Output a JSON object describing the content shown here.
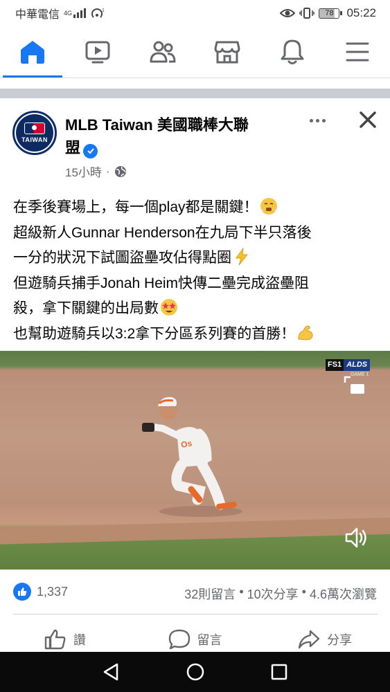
{
  "status_bar": {
    "carrier": "中華電信",
    "network": "4G",
    "battery": "78",
    "time": "05:22"
  },
  "nav": {
    "items": [
      {
        "icon": "home-icon",
        "active": true
      },
      {
        "icon": "video-icon",
        "active": false
      },
      {
        "icon": "friends-icon",
        "active": false
      },
      {
        "icon": "marketplace-icon",
        "active": false
      },
      {
        "icon": "bell-icon",
        "active": false
      },
      {
        "icon": "menu-icon",
        "active": false
      }
    ]
  },
  "post": {
    "page_name_line1": "MLB Taiwan 美國職棒大聯",
    "page_name_line2": "盟",
    "avatar_text": "TAIWAN",
    "time": "15小時",
    "audience_icon": "globe-icon",
    "text_lines": [
      {
        "text": "在季後賽場上，每一個play都是關鍵！",
        "emoji": "steam-face-emoji"
      },
      {
        "text": "超級新人Gunnar Henderson在九局下半只落後",
        "emoji": ""
      },
      {
        "text": "一分的狀況下試圖盜壘攻佔得點圈",
        "emoji": "lightning-emoji"
      },
      {
        "text": "但遊騎兵捕手Jonah Heim快傳二壘完成盜壘阻",
        "emoji": ""
      },
      {
        "text": "殺，拿下關鍵的出局數",
        "emoji": "star-struck-emoji"
      },
      {
        "text": "也幫助遊騎兵以3:2拿下分區系列賽的首勝！",
        "emoji": "flexed-bicep-emoji"
      }
    ],
    "video": {
      "network_badge": "FS1",
      "series_badge": "ALDS",
      "game_label": "GAME 1"
    },
    "reaction_count": "1,337",
    "comments": "32則留言",
    "shares": "10次分享",
    "views": "4.6萬次瀏覽",
    "separator": " • ",
    "actions": {
      "like": "讚",
      "comment": "留言",
      "share": "分享"
    }
  },
  "colors": {
    "accent": "#1877f2",
    "secondary_text": "#65676b",
    "separator": "#c9ccd1"
  }
}
